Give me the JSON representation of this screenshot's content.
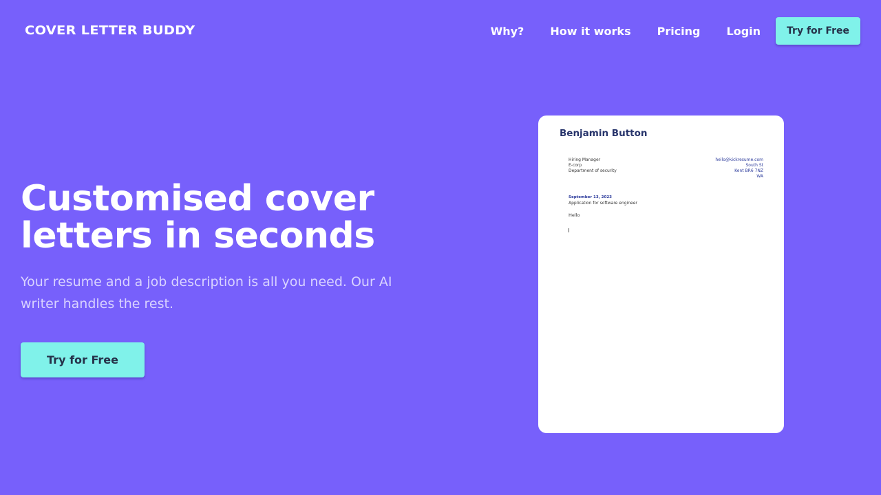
{
  "header": {
    "logo": "COVER LETTER BUDDY",
    "nav": {
      "why": "Why?",
      "how": "How it works",
      "pricing": "Pricing",
      "login": "Login",
      "cta": "Try for Free"
    }
  },
  "hero": {
    "title": "Customised cover letters in seconds",
    "subtitle": "Your resume and a job description is all you need. Our AI writer handles the rest.",
    "cta": "Try for Free"
  },
  "letter": {
    "name": "Benjamin Button",
    "recipient": [
      "Hiring Manager",
      "E-corp",
      "Department of security"
    ],
    "sender": [
      "hello@kickresume.com",
      "South St",
      "Kent BR6 7NZ",
      "WA"
    ],
    "date": "September 13, 2023",
    "subject": "Application for software engineer",
    "greeting": "Hello"
  },
  "colors": {
    "background": "#7760fb",
    "accent": "#80f2ea",
    "button_text": "#26324a"
  }
}
